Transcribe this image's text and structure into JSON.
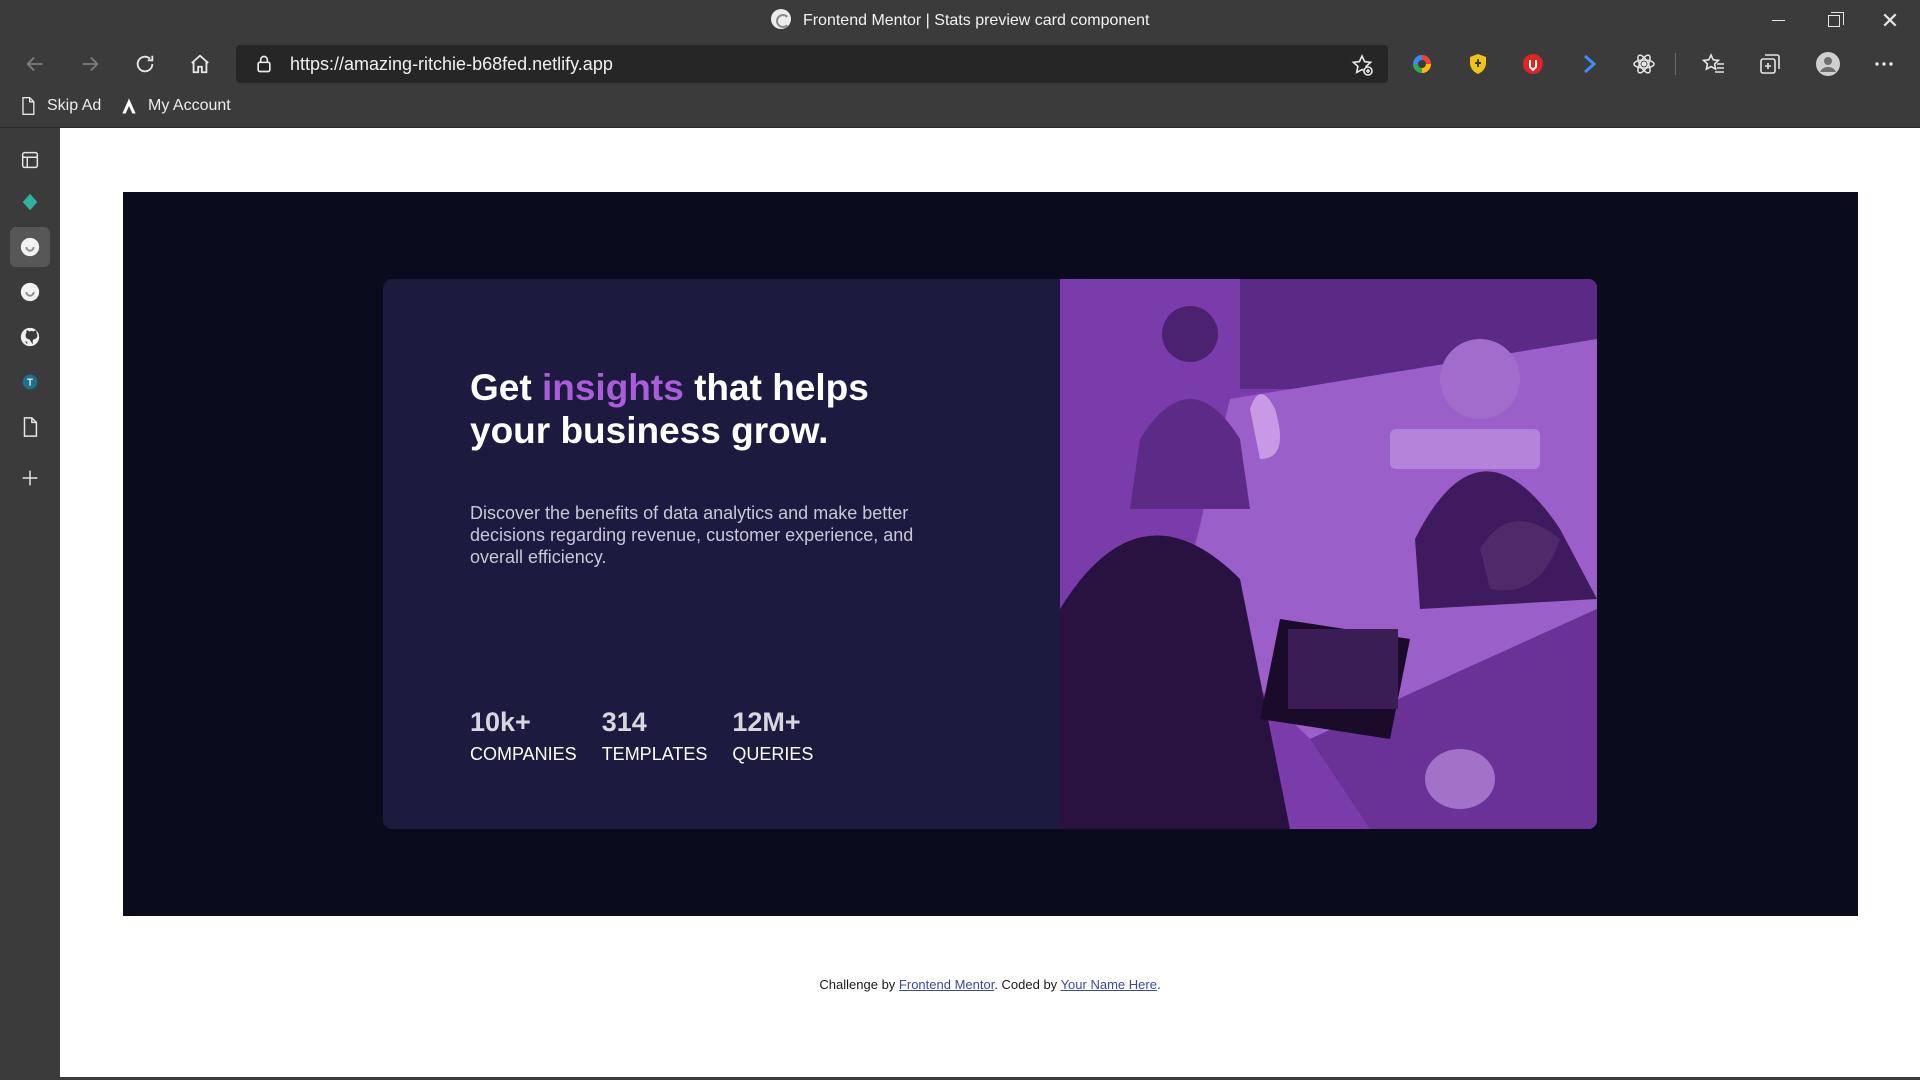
{
  "browser": {
    "window_title": "Frontend Mentor | Stats preview card component",
    "url": "https://amazing-ritchie-b68fed.netlify.app",
    "bookmarks": [
      {
        "label": "Skip Ad",
        "icon": "page-icon"
      },
      {
        "label": "My Account",
        "icon": "account-logo-icon"
      }
    ],
    "extensions": [
      "google-translate-icon",
      "shield-extension-icon",
      "adblock-icon",
      "arrow-extension-icon",
      "react-devtools-icon"
    ],
    "sidebar_icons": [
      "tab-actions-icon",
      "sketch-diamond-icon",
      "frontend-mentor-icon",
      "frontend-mentor-icon",
      "github-icon",
      "teal-t-icon",
      "page-icon",
      "add-icon"
    ]
  },
  "card": {
    "headline_before": "Get ",
    "headline_accent": "insights",
    "headline_after": " that helps your business grow.",
    "description": "Discover the benefits of data analytics and make better decisions regarding revenue, customer experience, and overall efficiency.",
    "stats": [
      {
        "value": "10k+",
        "label": "COMPANIES"
      },
      {
        "value": "314",
        "label": "TEMPLATES"
      },
      {
        "value": "12M+",
        "label": "QUERIES"
      }
    ],
    "colors": {
      "accent": "#ab5cdb",
      "card_bg": "#1c1a3e",
      "page_bg": "#0a0c1e",
      "image_tint": "#7a3aa8"
    }
  },
  "attribution": {
    "prefix": "Challenge by ",
    "link1": "Frontend Mentor",
    "middle": ". Coded by ",
    "link2": "Your Name Here",
    "suffix": "."
  }
}
